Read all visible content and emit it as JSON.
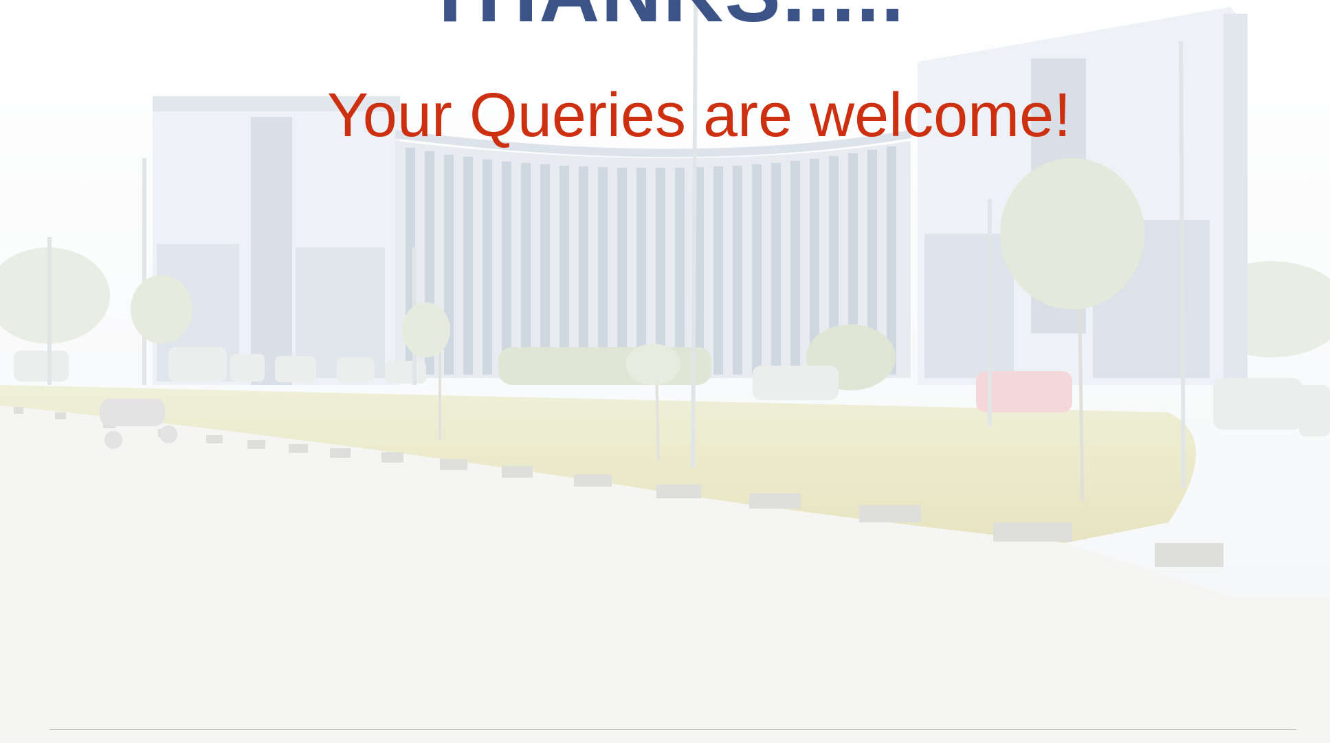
{
  "slide": {
    "title": "THANKS.....",
    "subtitle": "Your Queries are welcome!"
  },
  "colors": {
    "title": "#3b5386",
    "subtitle": "#cc3010",
    "sky": "#f7f8fa",
    "glass": "#d7dee6",
    "lawn": "#eae7c9",
    "road": "#f4f4f2"
  },
  "background": {
    "icon": "campus-building-photo"
  }
}
